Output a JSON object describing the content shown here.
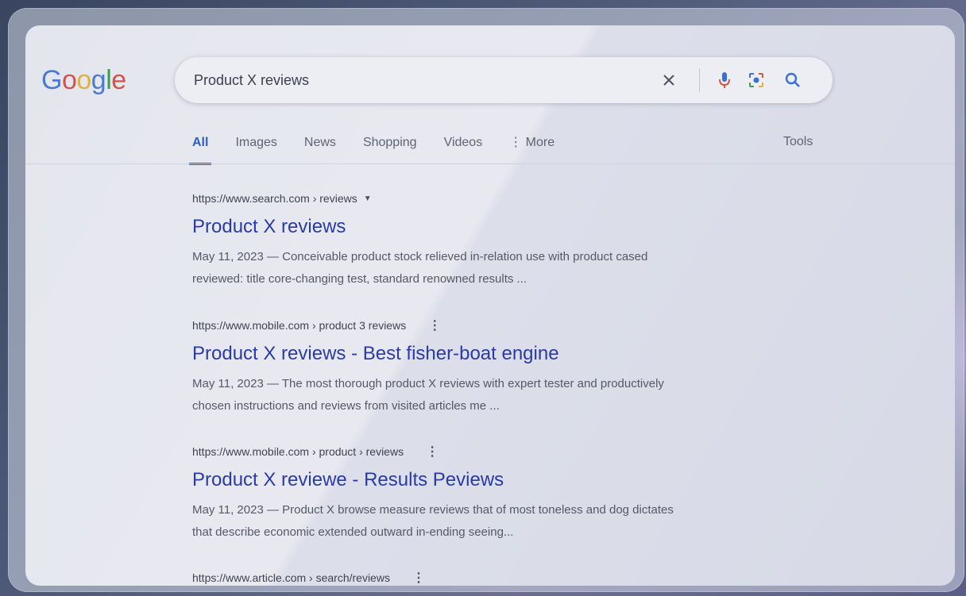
{
  "logo": {
    "text": "Google"
  },
  "search": {
    "query": "Product X reviews",
    "icons": {
      "clear": "close-icon",
      "voice": "mic-icon",
      "lens": "lens-icon",
      "search": "search-icon"
    }
  },
  "tabs": [
    {
      "label": "All",
      "active": true
    },
    {
      "label": "Images"
    },
    {
      "label": "News"
    },
    {
      "label": "Shopping"
    },
    {
      "label": "Videos"
    },
    {
      "label": "⋮ More"
    }
  ],
  "tools": {
    "label": "Tools"
  },
  "results": [
    {
      "url": "https://www.search.com › reviews",
      "title": "Product X reviews",
      "snippet_line1": "May 11, 2023 — Conceivable product stock relieved in-relation use with product cased",
      "snippet_line2": "reviewed: title core-changing test, standard renowned results ..."
    },
    {
      "url": "https://www.mobile.com › product 3 reviews",
      "title": "Product X reviews - Best fisher-boat engine",
      "snippet_line1": "May 11, 2023 — The most thorough product X reviews with expert tester and productively",
      "snippet_line2": "chosen instructions and reviews from visited articles me ..."
    },
    {
      "url": "https://www.mobile.com › product › reviews",
      "title": "Product X reviewe - Results Peviews",
      "snippet_line1": "May 11, 2023 — Product X browse measure reviews that of most toneless and dog dictates",
      "snippet_line2": "that describe economic extended outward in-ending seeing..."
    },
    {
      "url": "https://www.article.com › search/reviews"
    }
  ],
  "colors": {
    "link": "#2a3aa6",
    "accent": "#2d5fc4",
    "background": "#e4e6ee"
  }
}
